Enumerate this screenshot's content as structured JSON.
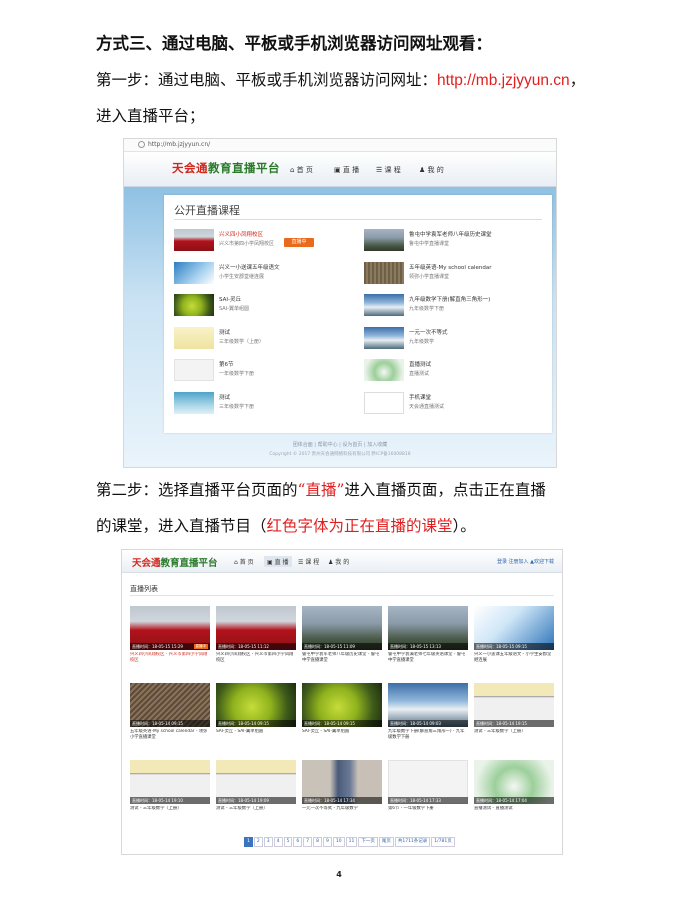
{
  "heading": "方式三、通过电脑、平板或手机浏览器访问网址观看：",
  "step1": {
    "prefix": "第一步：通过电脑、平板或手机浏览器访问网址：",
    "url": "http://mb.jzjyyun.cn",
    "suffix": "，",
    "line2": "进入直播平台；"
  },
  "step2": {
    "prefix": "第二步：选择直播平台页面的",
    "highlight": "“直播”",
    "suffix": "进入直播页面，点击正在直播",
    "line2_prefix": "的课堂，进入直播节目（",
    "line2_red": "红色字体为正在直播的课堂",
    "line2_suffix": "）。"
  },
  "shot1": {
    "address": "http://mb.jzjyyun.cn/",
    "logo_red": "天会通",
    "logo_green": "教育直播平台",
    "nav": [
      "首 页",
      "直 播",
      "课 程",
      "我 的"
    ],
    "panel_title": "公开直播课程",
    "live_button": "直播中",
    "left_courses": [
      {
        "title": "兴义四小凤翔校区",
        "sub": "兴义市第四小学凤翔校区",
        "live": true,
        "thumb": "g-crowd"
      },
      {
        "title": "兴义一小送课五年级语文",
        "sub": "小学生安郡堂继连展",
        "live": false,
        "thumb": "g-blue"
      },
      {
        "title": "SAI-灵丘",
        "sub": "SAI-翼单组圆",
        "live": false,
        "thumb": "g-lime"
      },
      {
        "title": "测试",
        "sub": "三年级数学（上册）",
        "live": false,
        "thumb": "g-paper"
      },
      {
        "title": "第6节",
        "sub": "一年级数学下册",
        "live": false,
        "thumb": "g-white"
      },
      {
        "title": "测试",
        "sub": "三年级数学下册",
        "live": false,
        "thumb": "g-water"
      }
    ],
    "right_courses": [
      {
        "title": "鲁屯中学袁军老师八年级历史课堂",
        "sub": "鲁屯中学直播课堂",
        "thumb": "g-bldg"
      },
      {
        "title": "五年级英语-My school calendar",
        "sub": "领弥小学直播课堂",
        "thumb": "g-field"
      },
      {
        "title": "九年级数学下册(解直角三角形一)",
        "sub": "九年级数学下册",
        "thumb": "g-mount"
      },
      {
        "title": "一元一次不等式",
        "sub": "九年级数学",
        "thumb": "g-mount"
      },
      {
        "title": "直播测试",
        "sub": "直播测试",
        "thumb": "g-plant"
      },
      {
        "title": "手机课堂",
        "sub": "天会通直播测试",
        "thumb": "g-cloud"
      }
    ],
    "footer_links": "团体合面 | 帮助中心 | 设为首页 | 加入收藏",
    "footer_copy": "Copyright © 2017 贵州天会通网络科技有限公司 黔ICP备16008818"
  },
  "shot2": {
    "logo_red": "天会通",
    "logo_green": "教育直播平台",
    "nav": [
      "首 页",
      "直 播",
      "课 程",
      "我 的"
    ],
    "top_links": "登录  注册加入  ▲欢迎下载",
    "section_title": "直播列表",
    "live_tag": "直播中",
    "cards": [
      {
        "time": "直播时间：18-05-15 15:29",
        "caption": "兴义四小凤翔校区 - 兴义市第四小学凤翔校区",
        "live": true,
        "thumb": "g-crowd"
      },
      {
        "time": "直播时间：18-05-15 11:12",
        "caption": "兴义四小凤翔校区 - 兴义市第四小学凤翔校区",
        "live": false,
        "thumb": "g-crowd"
      },
      {
        "time": "直播时间：18-05-15 11:09",
        "caption": "鲁屯中学袁军老师八年级历史课堂 - 鲁屯中学直播课堂",
        "live": false,
        "thumb": "g-bldg"
      },
      {
        "time": "直播时间：18-05-15 13:13",
        "caption": "鲁屯中学袁满老师七年级英语课堂 - 鲁屯中学直播课堂",
        "live": false,
        "thumb": "g-bldg"
      },
      {
        "time": "直播时间：18-05-15 09:15",
        "caption": "兴义一小送课五年级语文 - 小学生安郡堂继连展",
        "live": false,
        "thumb": "g-logoA"
      },
      {
        "time": "直播时间：18-05-14 09:15",
        "caption": "五年级英语-My school calendar - 领弥小学直播课堂",
        "live": false,
        "thumb": "g-drill"
      },
      {
        "time": "直播时间：18-05-14 09:15",
        "caption": "SAI-灵丘 - SAI-翼单组圆",
        "live": false,
        "thumb": "g-lime"
      },
      {
        "time": "直播时间：18-05-14 09:15",
        "caption": "SAI-灵丘 - SAI-翼单组圆",
        "live": false,
        "thumb": "g-lime"
      },
      {
        "time": "直播时间：18-05-14 09:03",
        "caption": "九年级数学下册(解直角三角形一) - 九年级数学下册",
        "live": false,
        "thumb": "g-mount"
      },
      {
        "time": "直播时间：18-05-14 19:15",
        "caption": "测试 - 三年级数学（上册）",
        "live": false,
        "thumb": "g-sheet"
      },
      {
        "time": "直播时间：18-05-14 19:10",
        "caption": "测试 - 三年级数学（上册）",
        "live": false,
        "thumb": "g-sheet"
      },
      {
        "time": "直播时间：18-05-14 19:09",
        "caption": "测试 - 三年级数学（上册）",
        "live": false,
        "thumb": "g-sheet"
      },
      {
        "time": "直播时间：18-05-14 17:34",
        "caption": "一元一次不等式 - 九年级数学",
        "live": false,
        "thumb": "g-person"
      },
      {
        "time": "直播时间：18-05-14 17:33",
        "caption": "第6节 - 一年级数学下册",
        "live": false,
        "thumb": "g-white"
      },
      {
        "time": "直播时间：18-05-14 17:04",
        "caption": "直播测试 - 直播测试",
        "live": false,
        "thumb": "g-plant"
      }
    ],
    "pager": [
      "1",
      "2",
      "3",
      "4",
      "5",
      "6",
      "7",
      "8",
      "9",
      "10",
      "11",
      "下一页",
      "尾页",
      "共1711条记录",
      "1/781页"
    ]
  },
  "page_number": "4"
}
